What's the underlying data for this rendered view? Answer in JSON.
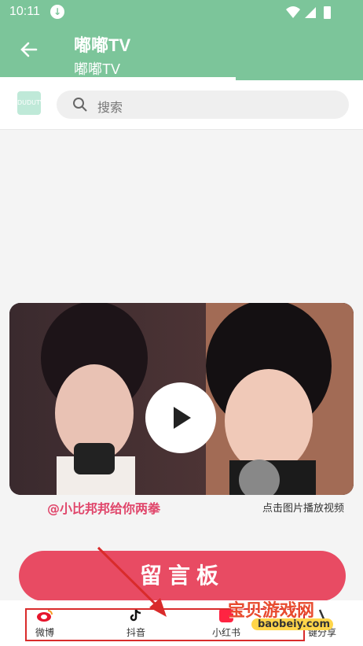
{
  "status_bar": {
    "time": "10:11"
  },
  "app_bar": {
    "title": "嘟嘟TV",
    "subtitle": "嘟嘟TV"
  },
  "progress": {
    "fraction": 0.65
  },
  "search": {
    "logo_text": "DUDUTV",
    "placeholder": "搜索"
  },
  "video": {
    "uploader": "@小比邦邦给你两拳",
    "hint": "点击图片播放视频"
  },
  "guestbook": {
    "label": "留言板"
  },
  "bottom_tabs": [
    {
      "label": "微博",
      "icon": "weibo-icon"
    },
    {
      "label": "抖音",
      "icon": "douyin-icon"
    },
    {
      "label": "小红书",
      "icon": "xiaohongshu-icon"
    },
    {
      "label": "键分享",
      "icon": "share-icon"
    }
  ],
  "watermark": {
    "text": "宝贝游戏网",
    "url": "baobeiy.com"
  },
  "colors": {
    "accent": "#7cc59a",
    "button": "#e84b63",
    "annotation": "#d92b2b"
  }
}
